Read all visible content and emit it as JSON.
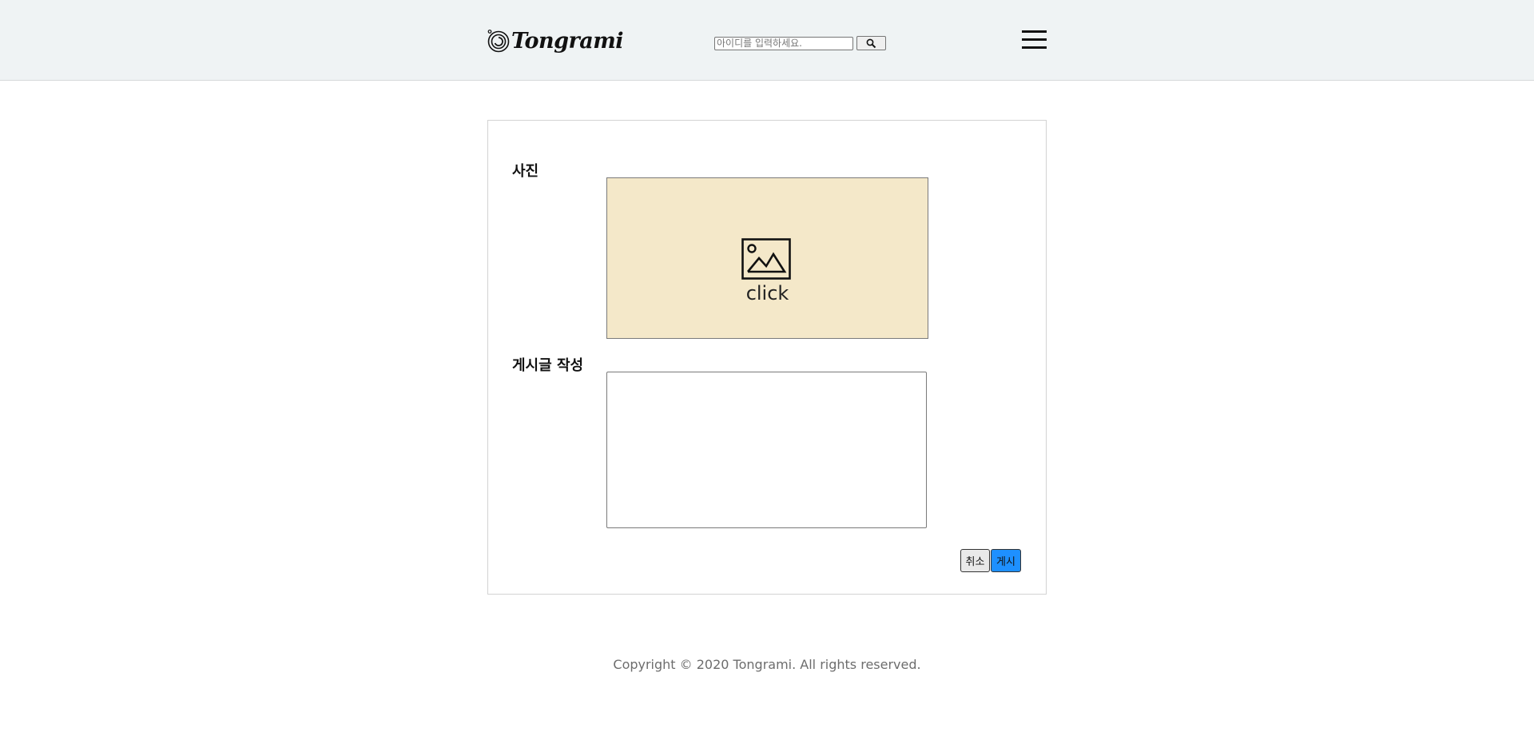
{
  "header": {
    "logo_text": "Tongrami",
    "search": {
      "placeholder": "아이디를 입력하세요.",
      "value": "",
      "button_icon": "search-icon"
    },
    "menu_icon": "hamburger-menu-icon"
  },
  "form": {
    "photo_label": "사진",
    "photo_upload": {
      "icon": "image-icon",
      "text": "click"
    },
    "post_label": "게시글 작성",
    "post_textarea": {
      "value": ""
    },
    "cancel_label": "취소",
    "submit_label": "게시"
  },
  "footer": {
    "copyright": "Copyright © 2020 Tongrami. All rights reserved."
  },
  "colors": {
    "header_bg": "#eff3f4",
    "photo_box_bg": "#f4e8c9",
    "submit_button_bg": "#1e90ff",
    "cancel_button_bg": "#e9e9e9"
  }
}
